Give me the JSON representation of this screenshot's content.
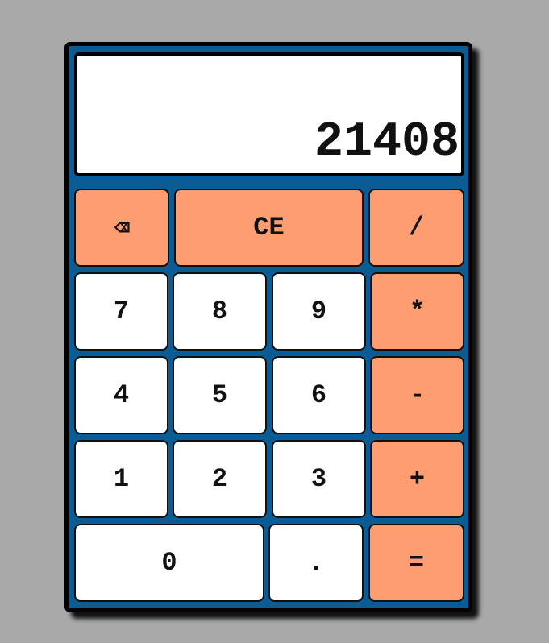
{
  "display": {
    "value": "21408"
  },
  "keys": {
    "backspace": "⌫",
    "clear": "CE",
    "divide": "/",
    "seven": "7",
    "eight": "8",
    "nine": "9",
    "multiply": "*",
    "four": "4",
    "five": "5",
    "six": "6",
    "subtract": "-",
    "one": "1",
    "two": "2",
    "three": "3",
    "add": "+",
    "zero": "0",
    "decimal": ".",
    "equals": "="
  },
  "colors": {
    "page_background": "#a9a9a9",
    "calculator_body": "#0b5c94",
    "operator_key": "#ff9d72",
    "digit_key": "#ffffff",
    "display_background": "#ffffff"
  }
}
